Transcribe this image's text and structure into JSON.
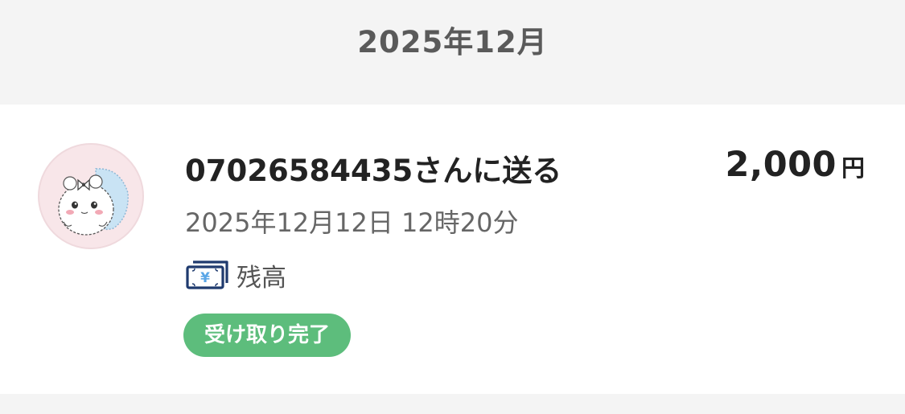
{
  "month_header": {
    "label": "2025年12月"
  },
  "transaction": {
    "title": "07026584435さんに送る",
    "amount": "2,000",
    "currency": "円",
    "datetime": "2025年12月12日 12時20分",
    "payment_method": {
      "label": "残高",
      "icon": "yen-bill-icon"
    },
    "status": "受け取り完了",
    "avatar_icon": "hamster-avatar-icon"
  },
  "colors": {
    "status_green": "#5dbd7c",
    "icon_navy": "#1f3a6e",
    "icon_light_blue": "#5aa6e6",
    "avatar_bg": "#f8e6e9",
    "background": "#f4f4f4"
  }
}
